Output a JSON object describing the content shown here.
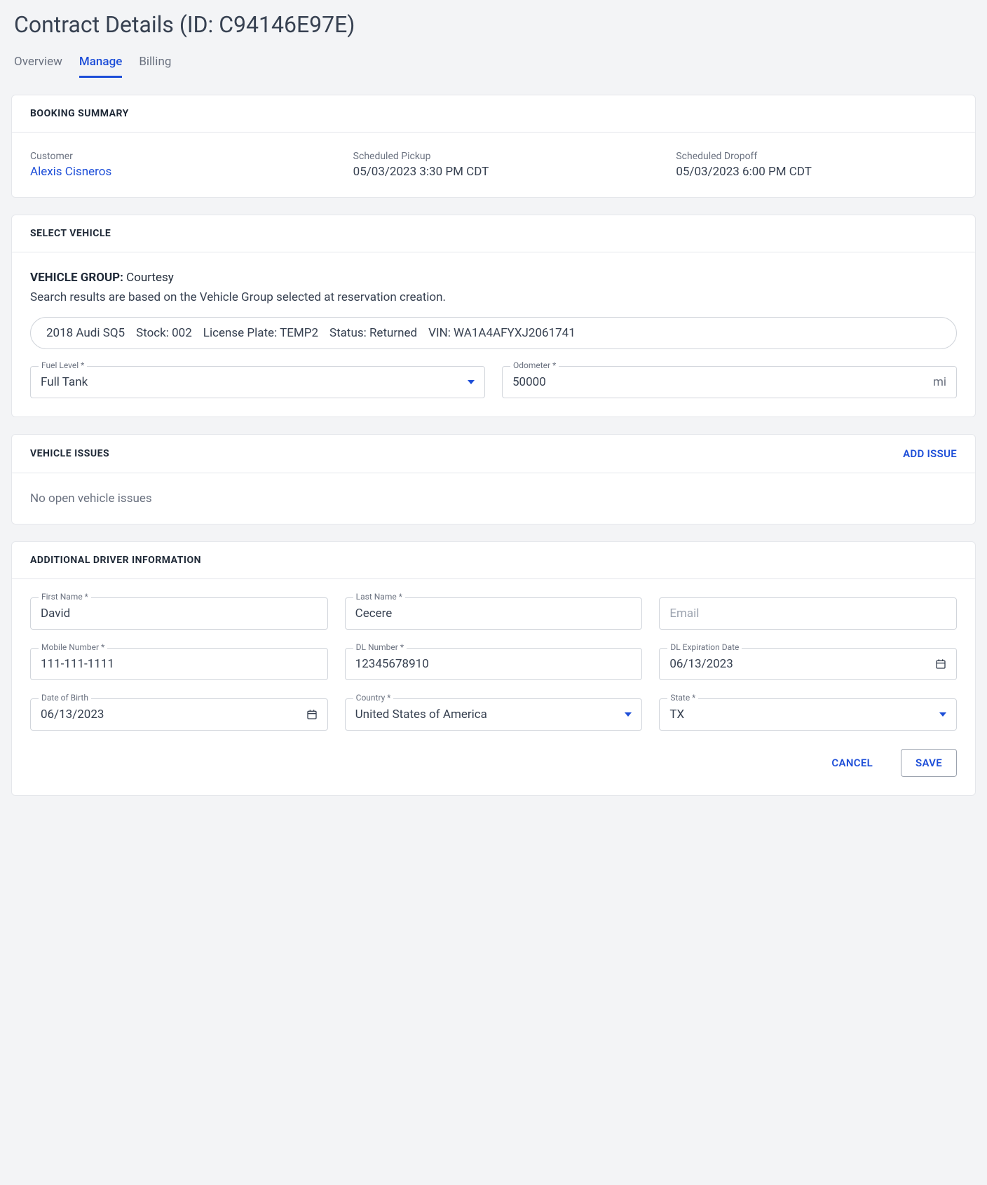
{
  "page_title": "Contract Details (ID: C94146E97E)",
  "tabs": {
    "overview": "Overview",
    "manage": "Manage",
    "billing": "Billing"
  },
  "booking": {
    "header": "BOOKING SUMMARY",
    "customer_label": "Customer",
    "customer_name": "Alexis Cisneros",
    "pickup_label": "Scheduled Pickup",
    "pickup_value": "05/03/2023 3:30 PM CDT",
    "dropoff_label": "Scheduled Dropoff",
    "dropoff_value": "05/03/2023 6:00 PM CDT"
  },
  "vehicle": {
    "header": "SELECT VEHICLE",
    "group_label": "VEHICLE GROUP:",
    "group_value": "Courtesy",
    "hint": "Search results are based on the Vehicle Group selected at reservation creation.",
    "pill": {
      "model": "2018 Audi SQ5",
      "stock": "Stock: 002",
      "plate": "License Plate: TEMP2",
      "status": "Status: Returned",
      "vin": "VIN: WA1A4AFYXJ2061741"
    },
    "fuel_label": "Fuel Level *",
    "fuel_value": "Full Tank",
    "odometer_label": "Odometer *",
    "odometer_value": "50000",
    "odometer_unit": "mi"
  },
  "issues": {
    "header": "VEHICLE ISSUES",
    "add_label": "ADD ISSUE",
    "empty": "No open vehicle issues"
  },
  "driver": {
    "header": "ADDITIONAL DRIVER INFORMATION",
    "first_name_label": "First Name *",
    "first_name_value": "David",
    "last_name_label": "Last Name *",
    "last_name_value": "Cecere",
    "email_placeholder": "Email",
    "mobile_label": "Mobile Number *",
    "mobile_value": "111-111-1111",
    "dl_label": "DL Number *",
    "dl_value": "12345678910",
    "dl_exp_label": "DL Expiration Date",
    "dl_exp_value": "06/13/2023",
    "dob_label": "Date of Birth",
    "dob_value": "06/13/2023",
    "country_label": "Country *",
    "country_value": "United States of America",
    "state_label": "State *",
    "state_value": "TX"
  },
  "actions": {
    "cancel": "CANCEL",
    "save": "SAVE"
  }
}
